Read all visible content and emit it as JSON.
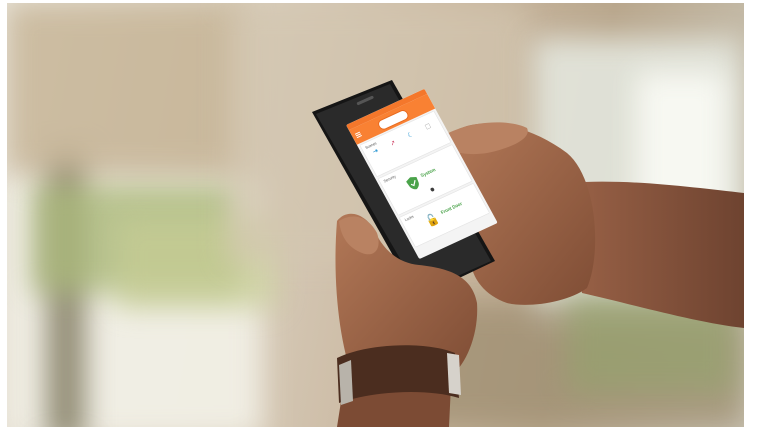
{
  "photo": {
    "description_colors": {
      "accent_orange": "#f98133",
      "secure_green": "#4aa34a",
      "scene_blue": "#1a8fd0"
    }
  },
  "phone_app": {
    "status_bar": {
      "time": ""
    },
    "app_bar": {
      "logo_text": ""
    },
    "scenes_card": {
      "title": "Scenes",
      "items": [
        {
          "label": "",
          "icon": "arrive-icon"
        },
        {
          "label": "",
          "icon": "leave-icon"
        },
        {
          "label": "",
          "icon": "sleep-icon"
        },
        {
          "label": "",
          "icon": "wake-icon"
        }
      ]
    },
    "security_card": {
      "title": "Security",
      "state": "System",
      "substate": ""
    },
    "locks_card": {
      "title": "Locks",
      "lock_name": "Front Door",
      "lock_state": ""
    }
  }
}
